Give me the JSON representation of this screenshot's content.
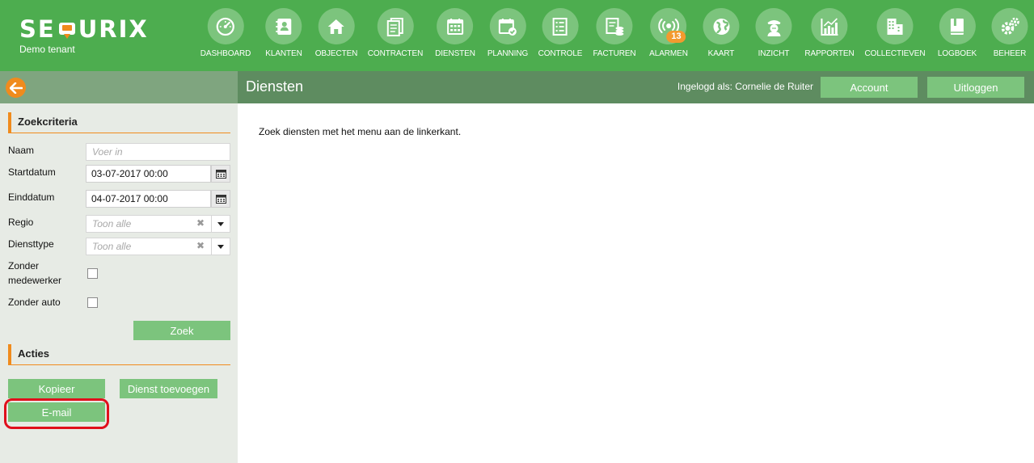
{
  "brand": {
    "logo_left": "SE",
    "logo_right": "URIX",
    "tenant": "Demo tenant"
  },
  "nav": [
    {
      "label": "DASHBOARD",
      "icon": "gauge-icon"
    },
    {
      "label": "KLANTEN",
      "icon": "contacts-book-icon"
    },
    {
      "label": "OBJECTEN",
      "icon": "home-icon"
    },
    {
      "label": "CONTRACTEN",
      "icon": "documents-icon"
    },
    {
      "label": "DIENSTEN",
      "icon": "calendar-grid-icon"
    },
    {
      "label": "PLANNING",
      "icon": "calendar-check-icon"
    },
    {
      "label": "CONTROLE",
      "icon": "checklist-icon"
    },
    {
      "label": "FACTUREN",
      "icon": "invoice-coins-icon"
    },
    {
      "label": "ALARMEN",
      "icon": "broadcast-icon",
      "badge": "13"
    },
    {
      "label": "KAART",
      "icon": "globe-icon"
    },
    {
      "label": "INZICHT",
      "icon": "guard-icon"
    },
    {
      "label": "RAPPORTEN",
      "icon": "bar-chart-icon"
    },
    {
      "label": "COLLECTIEVEN",
      "icon": "buildings-icon"
    },
    {
      "label": "LOGBOEK",
      "icon": "book-icon"
    },
    {
      "label": "BEHEER",
      "icon": "gears-icon"
    }
  ],
  "header": {
    "page_title": "Diensten",
    "logged_in": "Ingelogd als: Cornelie de Ruiter",
    "account_label": "Account",
    "logout_label": "Uitloggen"
  },
  "search": {
    "title": "Zoekcriteria",
    "name_label": "Naam",
    "name_placeholder": "Voer in",
    "start_label": "Startdatum",
    "start_value": "03-07-2017 00:00",
    "end_label": "Einddatum",
    "end_value": "04-07-2017 00:00",
    "region_label": "Regio",
    "region_value": "Toon alle",
    "type_label": "Diensttype",
    "type_value": "Toon alle",
    "no_employee_label_1": "Zonder",
    "no_employee_label_2": "medewerker",
    "no_car_label": "Zonder auto",
    "search_button": "Zoek"
  },
  "actions": {
    "title": "Acties",
    "copy_button": "Kopieer",
    "add_button": "Dienst toevoegen",
    "email_button": "E-mail"
  },
  "main": {
    "message": "Zoek diensten met het menu aan de linkerkant."
  },
  "colors": {
    "nav_green": "#4dad4f",
    "button_green": "#7cc47d",
    "accent_orange": "#f08b1d",
    "highlight_red": "#e0101c"
  }
}
